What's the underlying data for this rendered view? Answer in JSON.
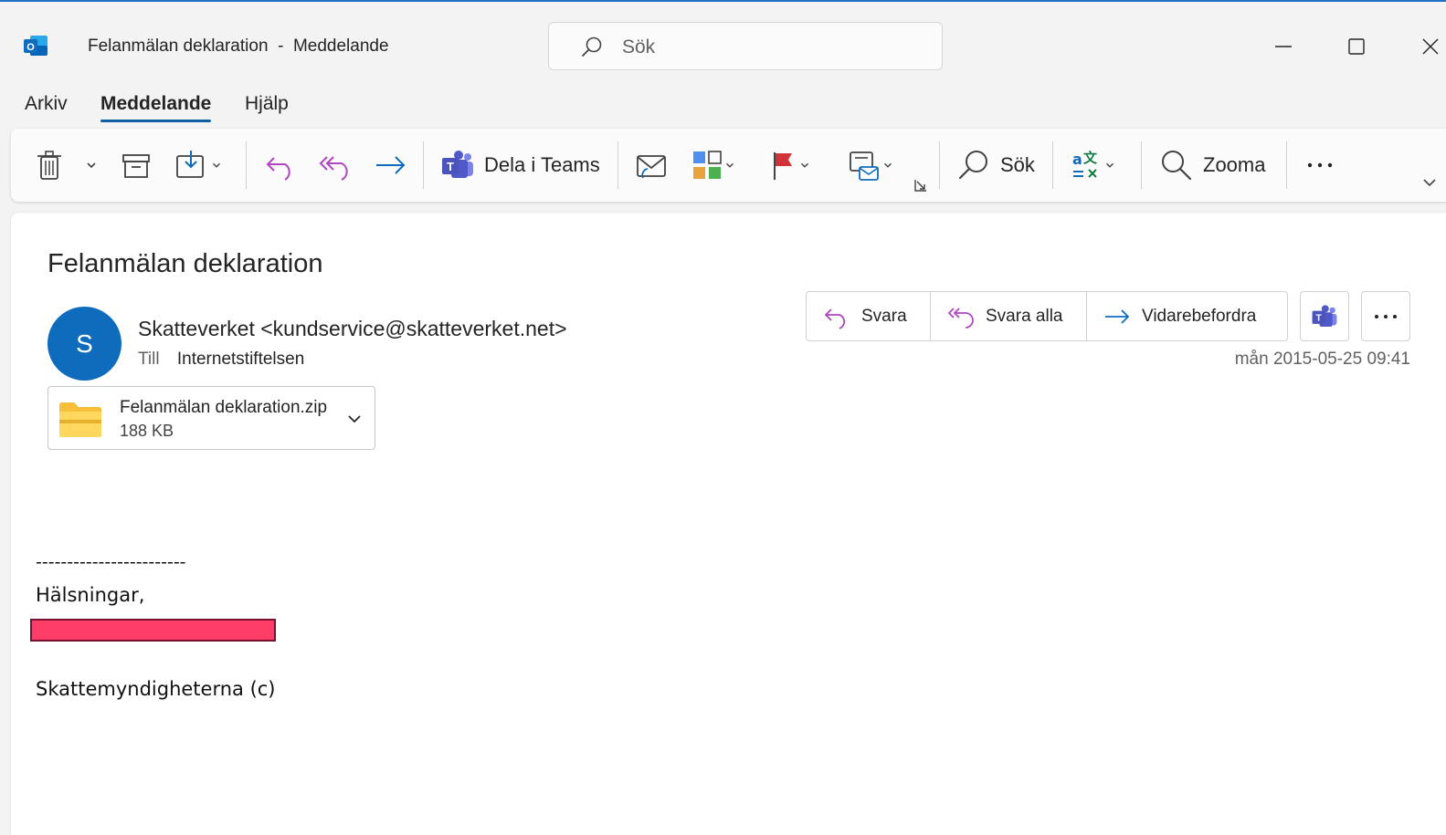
{
  "window": {
    "title": "Felanmälan deklaration  -  Meddelande",
    "app_icon": "outlook-icon"
  },
  "search": {
    "placeholder": "Sök"
  },
  "window_controls": [
    "minimize-icon",
    "maximize-icon",
    "close-icon"
  ],
  "menu": {
    "tabs": [
      {
        "label": "Arkiv",
        "active": false
      },
      {
        "label": "Meddelande",
        "active": true
      },
      {
        "label": "Hjälp",
        "active": false
      }
    ]
  },
  "ribbon": {
    "share_teams_label": "Dela i Teams",
    "search_label": "Sök",
    "zoom_label": "Zooma",
    "icons": [
      "delete-icon",
      "archive-icon",
      "move-icon",
      "reply-icon",
      "reply-all-icon",
      "forward-icon",
      "teams-icon",
      "read-unread-icon",
      "categorize-icon",
      "flag-icon",
      "rules-icon",
      "search-icon",
      "translate-icon",
      "zoom-icon",
      "more-icon"
    ]
  },
  "message": {
    "subject": "Felanmälan deklaration",
    "avatar_initial": "S",
    "sender": "Skatteverket <kundservice@skatteverket.net>",
    "to_label": "Till",
    "to_value": "Internetstiftelsen",
    "date": "mån 2015-05-25 09:41",
    "attachment": {
      "name": "Felanmälan deklaration.zip",
      "size": "188 KB"
    },
    "actions": {
      "reply": "Svara",
      "reply_all": "Svara alla",
      "forward": "Vidarebefordra"
    },
    "body": {
      "divider": "------------------------",
      "greeting": "Hälsningar,",
      "signature": "Skattemyndigheterna (c)"
    }
  },
  "colors": {
    "accent": "#0f6cbd",
    "reply_purple": "#b146c2",
    "forward_blue": "#0f6cbd",
    "flag_red": "#d13438",
    "redaction": "#fd3d67"
  }
}
